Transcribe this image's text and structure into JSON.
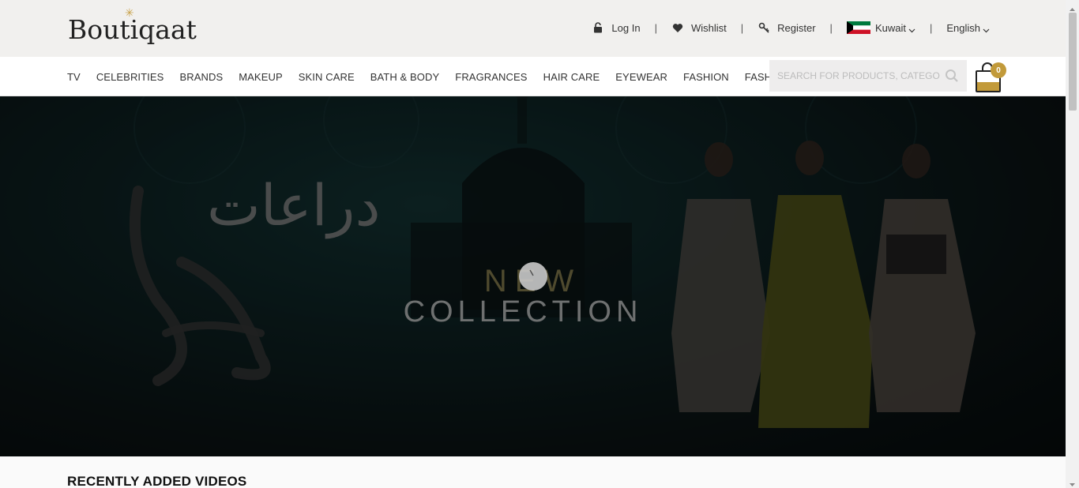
{
  "brand": {
    "logo_text": "Boutiqaat"
  },
  "top_links": {
    "login": "Log In",
    "wishlist": "Wishlist",
    "register": "Register",
    "country": "Kuwait",
    "language": "English",
    "separator": "|"
  },
  "nav": {
    "items": [
      "TV",
      "CELEBRITIES",
      "BRANDS",
      "MAKEUP",
      "SKIN CARE",
      "BATH & BODY",
      "FRAGRANCES",
      "HAIR CARE",
      "EYEWEAR",
      "FASHION",
      "FASHION TECH"
    ]
  },
  "search": {
    "placeholder": "SEARCH FOR PRODUCTS, CATEGORIES"
  },
  "cart": {
    "count": "0"
  },
  "hero": {
    "arabic_text": "دراعات",
    "headline_1": "NEW",
    "headline_2": "COLLECTION"
  },
  "sections": {
    "recent_videos_title": "RECENTLY ADDED VIDEOS"
  },
  "colors": {
    "accent": "#c29a3a",
    "topbar_bg": "#f1f0ee",
    "hero_bg": "#0f2627"
  },
  "icons": {
    "login": "lock-icon",
    "wishlist": "heart-icon",
    "register": "key-icon",
    "country_flag": "kuwait-flag-icon",
    "dropdown": "chevron-down-icon",
    "search": "search-icon",
    "cart": "shopping-bag-icon"
  }
}
